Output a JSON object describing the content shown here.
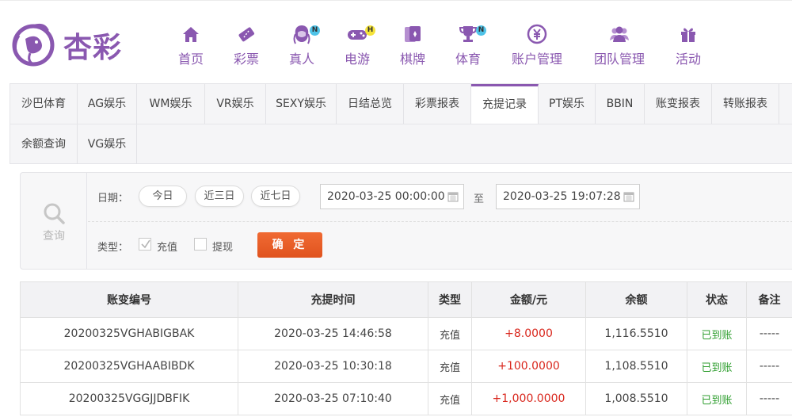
{
  "brand": {
    "logo_text": "杏彩"
  },
  "nav": [
    {
      "label": "首页",
      "icon": "home-icon"
    },
    {
      "label": "彩票",
      "icon": "lottery-ticket-icon"
    },
    {
      "label": "真人",
      "icon": "live-dealer-icon",
      "badge": "N"
    },
    {
      "label": "电游",
      "icon": "gamepad-icon",
      "badge": "H"
    },
    {
      "label": "棋牌",
      "icon": "cards-icon"
    },
    {
      "label": "体育",
      "icon": "trophy-icon",
      "badge": "N"
    },
    {
      "label": "账户管理",
      "icon": "yuan-coin-icon"
    },
    {
      "label": "团队管理",
      "icon": "team-icon"
    },
    {
      "label": "活动",
      "icon": "gift-icon"
    }
  ],
  "tabs": [
    {
      "label": "沙巴体育"
    },
    {
      "label": "AG娱乐"
    },
    {
      "label": "WM娱乐"
    },
    {
      "label": "VR娱乐"
    },
    {
      "label": "SEXY娱乐"
    },
    {
      "label": "日结总览"
    },
    {
      "label": "彩票报表"
    },
    {
      "label": "充提记录",
      "active": true
    },
    {
      "label": "PT娱乐"
    },
    {
      "label": "BBIN"
    },
    {
      "label": "账变报表"
    },
    {
      "label": "转账报表"
    },
    {
      "label": "余额查询"
    },
    {
      "label": "VG娱乐"
    }
  ],
  "filter": {
    "search_label": "查询",
    "date_label": "日期：",
    "quick_ranges": [
      "今日",
      "近三日",
      "近七日"
    ],
    "start_date": "2020-03-25 00:00:00",
    "to_label": "至",
    "end_date": "2020-03-25 19:07:28",
    "type_label": "类型：",
    "type_options": [
      {
        "label": "充值",
        "checked": true
      },
      {
        "label": "提现",
        "checked": false
      }
    ],
    "confirm_label": "确 定"
  },
  "table": {
    "headers": [
      "账变编号",
      "充提时间",
      "类型",
      "金额/元",
      "余额",
      "状态",
      "备注"
    ],
    "rows": [
      [
        "20200325VGHABIGBAK",
        "2020-03-25 14:46:58",
        "充值",
        "+8.0000",
        "1,116.5510",
        "已到账",
        "-----"
      ],
      [
        "20200325VGHAABIBDK",
        "2020-03-25 10:30:18",
        "充值",
        "+100.0000",
        "1,108.5510",
        "已到账",
        "-----"
      ],
      [
        "20200325VGGJJDBFIK",
        "2020-03-25 07:10:40",
        "充值",
        "+1,000.0000",
        "1,008.5510",
        "已到账",
        "-----"
      ]
    ]
  },
  "colors": {
    "brand_purple": "#8a58b0",
    "accent_orange": "#e8582a",
    "amount_red": "#d9261c",
    "status_green": "#2f9e2f",
    "badge_blue": "#4fc3e8",
    "badge_yellow": "#f5e33a"
  }
}
